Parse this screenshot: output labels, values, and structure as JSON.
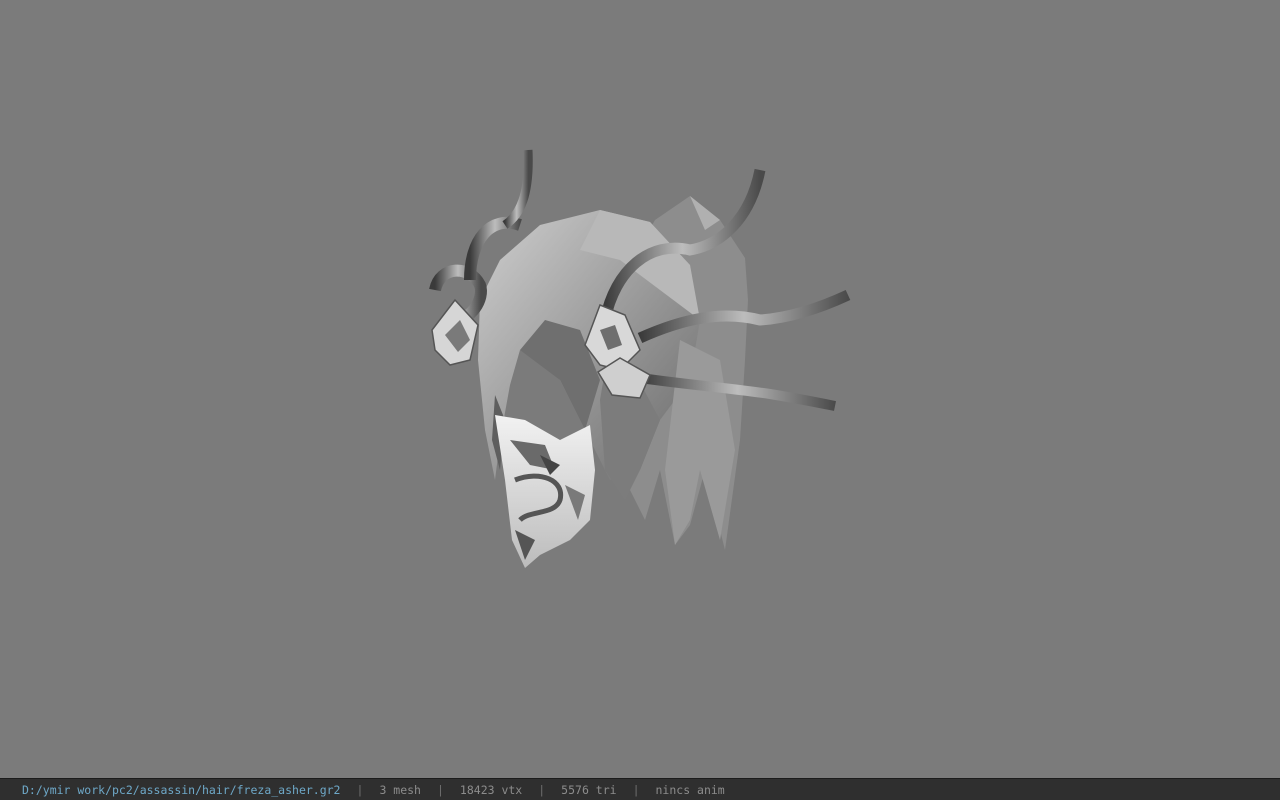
{
  "viewport": {
    "background_color": "#7b7b7b",
    "model_icon": "hair-model-icon"
  },
  "status_bar": {
    "file_path": "D:/ymir work/pc2/assassin/hair/freza_asher.gr2",
    "separator": "|",
    "mesh_count": "3 mesh",
    "vertex_count": "18423 vtx",
    "triangle_count": "5576 tri",
    "animation": "nincs anim",
    "path_color": "#6ea8c8",
    "text_color": "#8c8c8c"
  }
}
